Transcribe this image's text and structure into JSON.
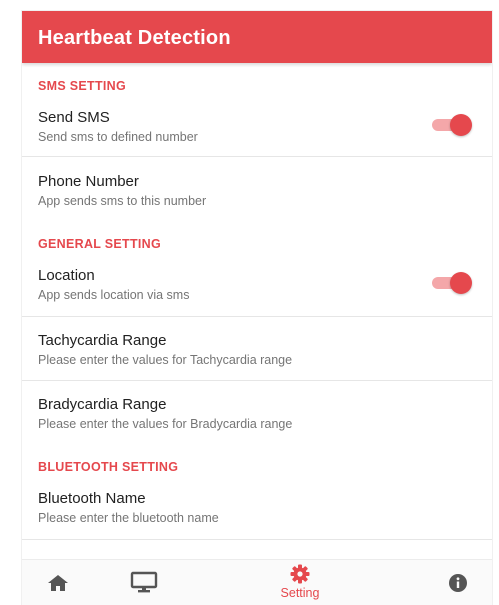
{
  "app_bar": {
    "title": "Heartbeat Detection"
  },
  "sections": {
    "sms": {
      "header": "SMS SETTING",
      "send_sms": {
        "title": "Send SMS",
        "subtitle": "Send sms to defined number",
        "enabled": true
      },
      "phone_number": {
        "title": "Phone Number",
        "subtitle": "App sends sms to this number"
      }
    },
    "general": {
      "header": "GENERAL SETTING",
      "location": {
        "title": "Location",
        "subtitle": "App sends location via sms",
        "enabled": true
      },
      "tachycardia": {
        "title": "Tachycardia Range",
        "subtitle": "Please enter the values for Tachycardia range"
      },
      "bradycardia": {
        "title": "Bradycardia Range",
        "subtitle": "Please enter the values for Bradycardia range"
      }
    },
    "bluetooth": {
      "header": "BLUETOOTH SETTING",
      "name": {
        "title": "Bluetooth Name",
        "subtitle": "Please enter the bluetooth name"
      }
    }
  },
  "bottom_nav": {
    "items": [
      {
        "icon": "home-icon"
      },
      {
        "icon": "monitor-icon"
      },
      {
        "icon": "gear-icon",
        "label": "Setting",
        "active": true
      },
      {
        "icon": "info-icon"
      }
    ]
  },
  "colors": {
    "primary": "#e5484d",
    "switch_track": "#f4a7a9",
    "title_text": "#212121",
    "subtitle_text": "#757575",
    "nav_icon": "#555555"
  }
}
